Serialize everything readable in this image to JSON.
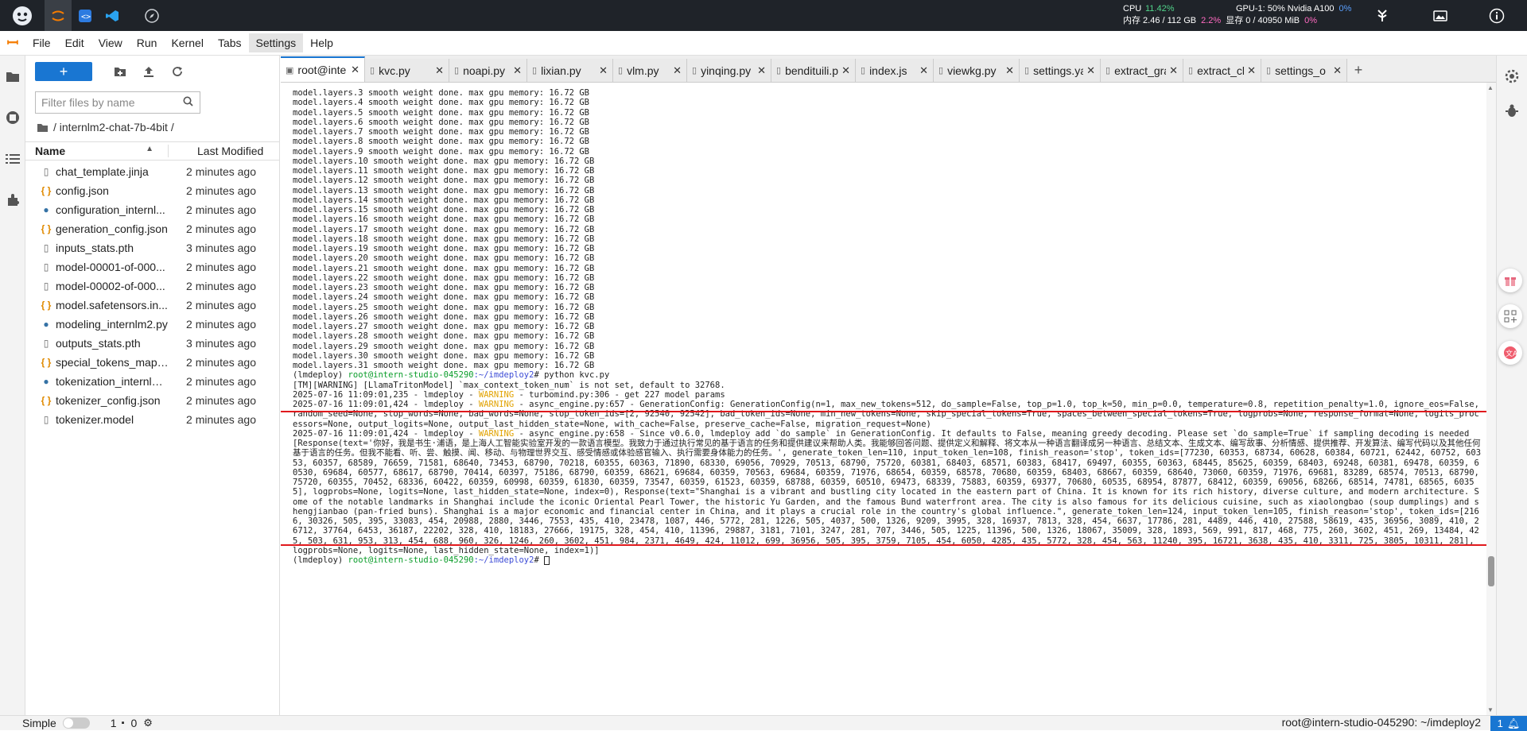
{
  "topbar": {
    "cpu_label": "CPU",
    "cpu_value": "11.42%",
    "mem_label": "内存 2.46 / 112 GB",
    "mem_value": "2.2%",
    "gpu_label": "GPU-1: 50% Nvidia A100",
    "gpu_value": "0%",
    "vram_label": "显存 0 / 40950 MiB",
    "vram_value": "0%"
  },
  "menu": {
    "items": [
      "File",
      "Edit",
      "View",
      "Run",
      "Kernel",
      "Tabs",
      "Settings",
      "Help"
    ]
  },
  "filebrowser": {
    "new_label": "+",
    "search_placeholder": "Filter files by name",
    "breadcrumb": "/ internlm2-chat-7b-4bit /",
    "col_name": "Name",
    "col_modified": "Last Modified",
    "files": [
      {
        "name": "chat_template.jinja",
        "modified": "2 minutes ago",
        "icon": "doc"
      },
      {
        "name": "config.json",
        "modified": "2 minutes ago",
        "icon": "json"
      },
      {
        "name": "configuration_internl...",
        "modified": "2 minutes ago",
        "icon": "py"
      },
      {
        "name": "generation_config.json",
        "modified": "2 minutes ago",
        "icon": "json"
      },
      {
        "name": "inputs_stats.pth",
        "modified": "3 minutes ago",
        "icon": "doc"
      },
      {
        "name": "model-00001-of-000...",
        "modified": "2 minutes ago",
        "icon": "doc"
      },
      {
        "name": "model-00002-of-000...",
        "modified": "2 minutes ago",
        "icon": "doc"
      },
      {
        "name": "model.safetensors.in...",
        "modified": "2 minutes ago",
        "icon": "json"
      },
      {
        "name": "modeling_internlm2.py",
        "modified": "2 minutes ago",
        "icon": "py"
      },
      {
        "name": "outputs_stats.pth",
        "modified": "3 minutes ago",
        "icon": "doc"
      },
      {
        "name": "special_tokens_map.j...",
        "modified": "2 minutes ago",
        "icon": "json"
      },
      {
        "name": "tokenization_internlm...",
        "modified": "2 minutes ago",
        "icon": "py"
      },
      {
        "name": "tokenizer_config.json",
        "modified": "2 minutes ago",
        "icon": "json"
      },
      {
        "name": "tokenizer.model",
        "modified": "2 minutes ago",
        "icon": "doc"
      }
    ]
  },
  "tabs": [
    {
      "name": "root@inte",
      "type": "terminal",
      "active": true
    },
    {
      "name": "kvc.py",
      "type": "file"
    },
    {
      "name": "noapi.py",
      "type": "file"
    },
    {
      "name": "lixian.py",
      "type": "file"
    },
    {
      "name": "vlm.py",
      "type": "file"
    },
    {
      "name": "yinqing.py",
      "type": "file"
    },
    {
      "name": "bendituili.p",
      "type": "file"
    },
    {
      "name": "index.js",
      "type": "file"
    },
    {
      "name": "viewkg.py",
      "type": "file"
    },
    {
      "name": "settings.ya",
      "type": "file"
    },
    {
      "name": "extract_gra",
      "type": "file"
    },
    {
      "name": "extract_cla",
      "type": "file"
    },
    {
      "name": "settings_o",
      "type": "file"
    }
  ],
  "terminal": {
    "layer_prefix": "model.layers.",
    "layer_suffix": " smooth weight done. max gpu memory: 16.72 GB",
    "layer_start": 3,
    "layer_end": 31,
    "env": "(lmdeploy) ",
    "user_host": "root@intern-studio-045290",
    "path": ":~/imdeploy2",
    "command": "# python kvc.py",
    "line_tm": "[TM][WARNING] [LlamaTritonModel] `max_context_token_num` is not set, default to 32768.",
    "line_warn1_pre": "2025-07-16 11:09:01,235 - lmdeploy - ",
    "warn_word": "WARNING",
    "line_warn1_post": " - turbomind.py:306 - get 227 model params",
    "line_warn2_pre": "2025-07-16 11:09:01,424 - lmdeploy - ",
    "line_warn2_post": " - async_engine.py:657 - GenerationConfig: GenerationConfig(n=1, max_new_tokens=512, do_sample=False, top_p=1.0, top_k=50, min_p=0.0, temperature=0.8, repetition_penalty=1.0, ignore_eos=False, random_seed=None, stop_words=None, bad_words=None, stop_token_ids=[2, 92540, 92542], bad_token_ids=None, min_new_tokens=None, skip_special_tokens=True, spaces_between_special_tokens=True, logprobs=None, response_format=None, logits_processors=None, output_logits=None, output_last_hidden_state=None, with_cache=False, preserve_cache=False, migration_request=None)",
    "line_warn3_pre": "2025-07-16 11:09:01,424 - lmdeploy - ",
    "line_warn3_post": " - async_engine.py:658 - Since v0.6.0, lmdeploy add `do_sample` in GenerationConfig. It defaults to False, meaning greedy decoding. Please set `do_sample=True` if sampling decoding is needed",
    "response": "[Response(text='你好，我是书生·浦语，是上海人工智能实验室开发的一款语言模型。我致力于通过执行常见的基于语言的任务和提供建议来帮助人类。我能够回答问题、提供定义和解释、将文本从一种语言翻译成另一种语言、总结文本、生成文本、编写故事、分析情感、提供推荐、开发算法、编写代码以及其他任何基于语言的任务。但我不能看、听、尝、触摸、闻、移动、与物理世界交互、感受情感或体验感官输入、执行需要身体能力的任务。', generate_token_len=110, input_token_len=108, finish_reason='stop', token_ids=[77230, 60353, 68734, 60628, 60384, 60721, 62442, 60752, 60353, 60357, 68589, 76659, 71581, 68640, 73453, 68790, 70218, 60355, 60363, 71890, 68330, 69056, 70929, 70513, 68790, 75720, 60381, 68403, 68571, 60383, 68417, 69497, 60355, 60363, 68445, 85625, 60359, 68403, 69248, 60381, 69478, 60359, 60530, 69684, 60577, 68617, 68790, 70414, 60397, 75186, 68790, 60359, 68621, 69684, 60359, 70563, 69684, 60359, 71976, 68654, 60359, 68578, 70680, 60359, 68403, 68667, 60359, 68640, 73060, 60359, 71976, 69681, 83289, 68574, 70513, 68790, 75720, 60355, 70452, 68336, 60422, 60359, 60998, 60359, 61830, 60359, 73547, 60359, 61523, 60359, 68788, 60359, 60510, 69473, 68339, 75883, 60359, 69377, 70680, 60535, 68954, 87877, 68412, 60359, 69056, 68266, 68514, 74781, 68565, 60355], logprobs=None, logits=None, last_hidden_state=None, index=0), Response(text=\"Shanghai is a vibrant and bustling city located in the eastern part of China. It is known for its rich history, diverse culture, and modern architecture. Some of the notable landmarks in Shanghai include the iconic Oriental Pearl Tower, the historic Yu Garden, and the famous Bund waterfront area. The city is also famous for its delicious cuisine, such as xiaolongbao (soup dumplings) and shengjianbao (pan-fried buns). Shanghai is a major economic and financial center in China, and it plays a crucial role in the country's global influence.\", generate_token_len=124, input_token_len=105, finish_reason='stop', token_ids=[2166, 30326, 505, 395, 33083, 454, 20988, 2880, 3446, 7553, 435, 410, 23478, 1087, 446, 5772, 281, 1226, 505, 4037, 500, 1326, 9209, 3995, 328, 16937, 7813, 328, 454, 6637, 17786, 281, 4489, 446, 410, 27588, 58619, 435, 36956, 3089, 410, 26712, 37764, 6453, 36187, 22202, 328, 410, 18183, 27666, 19175, 328, 454, 410, 11396, 29887, 3181, 7101, 3247, 281, 707, 3446, 505, 1225, 11396, 500, 1326, 18067, 35009, 328, 1893, 569, 991, 817, 468, 775, 260, 3602, 451, 269, 13484, 425, 503, 631, 953, 313, 454, 688, 960, 326, 1246, 260, 3602, 451, 984, 2371, 4649, 424, 11012, 699, 36956, 505, 395, 3759, 7105, 454, 6050, 4285, 435, 5772, 328, 454, 563, 11240, 395, 16721, 3638, 435, 410, 3311, 725, 3805, 10311, 281], logprobs=None, logits=None, last_hidden_state=None, index=1)]",
    "prompt_end": "# "
  },
  "statusbar": {
    "mode": "Simple",
    "count1": "1",
    "count2": "0",
    "right": "root@intern-studio-045290: ~/imdeploy2",
    "notifications": "1"
  }
}
